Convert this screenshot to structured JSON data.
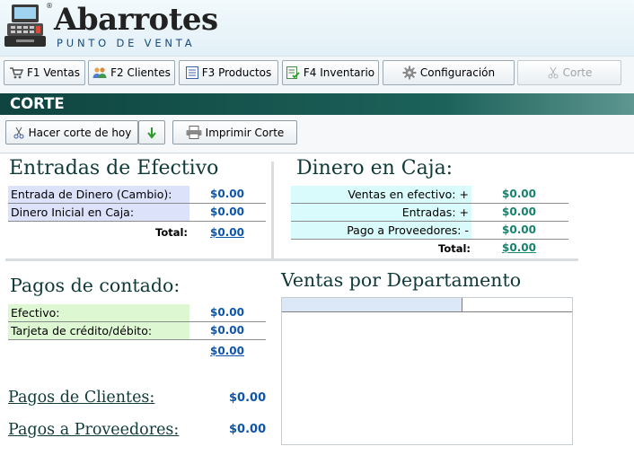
{
  "app": {
    "brand": "Abarrotes",
    "subtitle": "PUNTO DE VENTA",
    "registered": "®"
  },
  "toolbar": {
    "ventas": "F1 Ventas",
    "clientes": "F2 Clientes",
    "productos": "F3 Productos",
    "inventario": "F4 Inventario",
    "configuracion": "Configuración",
    "corte": "Corte"
  },
  "section": {
    "title": "CORTE"
  },
  "actions": {
    "hacer_corte": "Hacer corte de hoy",
    "imprimir": "Imprimir Corte"
  },
  "entradas": {
    "title": "Entradas de Efectivo",
    "rows": [
      {
        "label": "Entrada de Dinero (Cambio):",
        "value": "$0.00"
      },
      {
        "label": "Dinero Inicial en Caja:",
        "value": "$0.00"
      }
    ],
    "total_label": "Total:",
    "total_value": "$0.00"
  },
  "caja": {
    "title": "Dinero en Caja:",
    "rows": [
      {
        "label": "Ventas en efectivo:",
        "sign": "+",
        "value": "$0.00"
      },
      {
        "label": "Entradas:",
        "sign": "+",
        "value": "$0.00"
      },
      {
        "label": "Pago a Proveedores:",
        "sign": "-",
        "value": "$0.00"
      }
    ],
    "total_label": "Total:",
    "total_value": "$0.00"
  },
  "contado": {
    "title": "Pagos de contado:",
    "rows": [
      {
        "label": "Efectivo:",
        "value": "$0.00"
      },
      {
        "label": "Tarjeta de crédito/débito:",
        "value": "$0.00"
      }
    ],
    "total_value": "$0.00"
  },
  "pagos_clientes": {
    "label": "Pagos de Clientes:",
    "value": "$0.00"
  },
  "pagos_proveedores": {
    "label": "Pagos a Proveedores:",
    "value": "$0.00"
  },
  "departamento": {
    "title": "Ventas por Departamento"
  },
  "colors": {
    "section_bar": "#1c625a",
    "value_blue": "#0f55a8",
    "value_teal": "#16836f",
    "label_bg_blue": "#dde2fb",
    "label_bg_cyan": "#d9fbfb",
    "label_bg_green": "#def7d3"
  }
}
